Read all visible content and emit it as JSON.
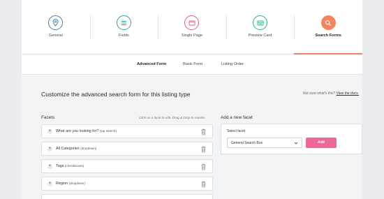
{
  "steps": [
    {
      "label": "General",
      "icon": "location-pin-icon",
      "color": "#4a7ea8"
    },
    {
      "label": "Fields",
      "icon": "list-icon",
      "color": "#2aa3a0"
    },
    {
      "label": "Single Page",
      "icon": "browser-window-icon",
      "color": "#e25c8d"
    },
    {
      "label": "Preview Card",
      "icon": "card-icon",
      "color": "#2bb08a"
    },
    {
      "label": "Search Forms",
      "icon": "search-icon",
      "color": "#f0865f"
    }
  ],
  "tabs": [
    "Advanced Form",
    "Basic Form",
    "Listing Order"
  ],
  "heading": "Customize the advanced search form for this listing type",
  "note": {
    "text": "Not sure what's this?",
    "link": "View the docs."
  },
  "facets": {
    "title": "Facets",
    "hint": "Click on a facet to edit. Drag & Drop to reorder.",
    "items": [
      {
        "label": "What are you looking for?",
        "type": "(wp search)"
      },
      {
        "label": "All Categories",
        "type": "(dropdown)"
      },
      {
        "label": "Tags",
        "type": "(checkboxes)"
      },
      {
        "label": "Region",
        "type": "(dropdown)"
      }
    ]
  },
  "add_facet": {
    "title": "Add a new facet",
    "select_label": "Select facet",
    "selected": "General Search Box",
    "button": "Add"
  }
}
